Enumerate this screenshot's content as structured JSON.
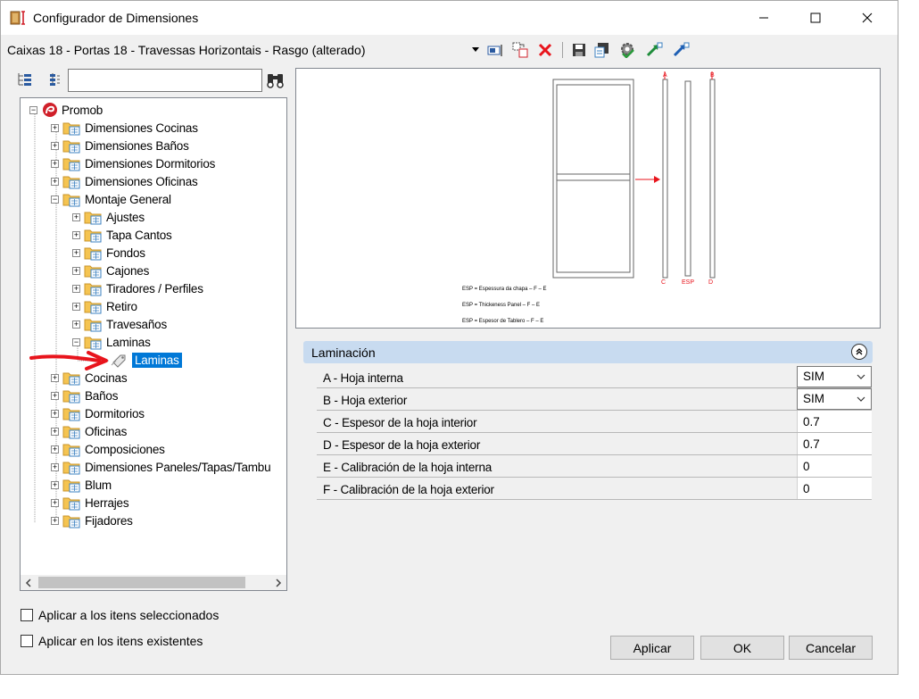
{
  "window": {
    "title": "Configurador de Dimensiones"
  },
  "toolbar": {
    "config_name": "Caixas 18 - Portas 18 - Travessas Horizontais - Rasgo (alterado)"
  },
  "tree": {
    "root": "Promob",
    "items": [
      {
        "label": "Dimensiones Cocinas"
      },
      {
        "label": "Dimensiones Baños"
      },
      {
        "label": "Dimensiones Dormitorios"
      },
      {
        "label": "Dimensiones Oficinas"
      },
      {
        "label": "Montaje General"
      },
      {
        "label": "Ajustes"
      },
      {
        "label": "Tapa Cantos"
      },
      {
        "label": "Fondos"
      },
      {
        "label": "Cajones"
      },
      {
        "label": "Tiradores / Perfiles"
      },
      {
        "label": "Retiro"
      },
      {
        "label": "Travesaños"
      },
      {
        "label": "Laminas"
      },
      {
        "label": "Laminas"
      },
      {
        "label": "Cocinas"
      },
      {
        "label": "Baños"
      },
      {
        "label": "Dormitorios"
      },
      {
        "label": "Oficinas"
      },
      {
        "label": "Composiciones"
      },
      {
        "label": "Dimensiones Paneles/Tapas/Tambu"
      },
      {
        "label": "Blum"
      },
      {
        "label": "Herrajes"
      },
      {
        "label": "Fijadores"
      }
    ]
  },
  "options": {
    "apply_selected": "Aplicar a los itens seleccionados",
    "apply_existing": "Aplicar en los itens existentes"
  },
  "preview": {
    "label_a": "A",
    "label_b": "B",
    "label_c": "C",
    "label_d": "D",
    "label_esp": "ESP",
    "legend": [
      "ESP = Espessura da chapa – F – E",
      "ESP = Thickeness Panel – F – E",
      "ESP = Espesor de Tablero – F – E"
    ]
  },
  "properties": {
    "group_title": "Laminación",
    "rows": [
      {
        "name": "A -  Hoja interna",
        "value": "SIM"
      },
      {
        "name": "B - Hoja exterior",
        "value": "SIM"
      },
      {
        "name": "C -  Espesor de la hoja interior",
        "value": "0.7"
      },
      {
        "name": "D - Espesor de la hoja exterior",
        "value": "0.7"
      },
      {
        "name": "E -  Calibración de la hoja interna",
        "value": "0"
      },
      {
        "name": "F - Calibración de la hoja exterior",
        "value": "0"
      }
    ]
  },
  "buttons": {
    "apply": "Aplicar",
    "ok": "OK",
    "cancel": "Cancelar"
  },
  "colors": {
    "selection": "#0078d7",
    "group_header": "#c8dbf0",
    "arrow_annotation": "#e8141c"
  }
}
